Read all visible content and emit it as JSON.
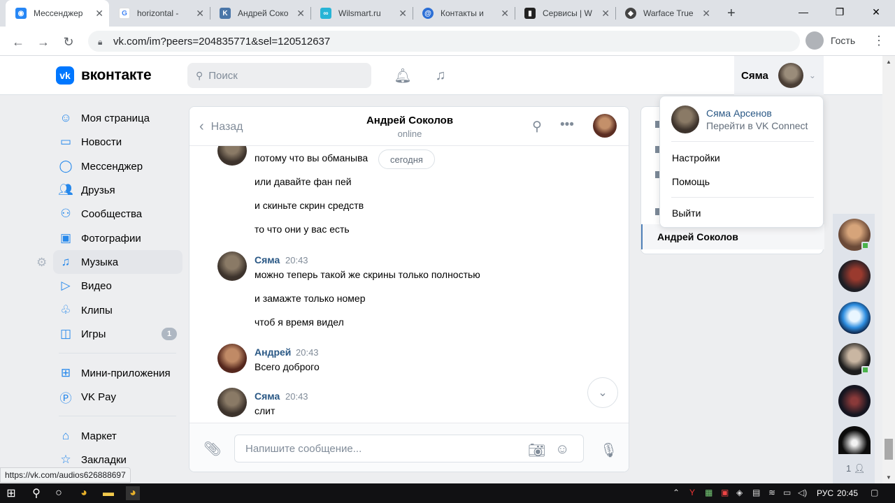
{
  "browser": {
    "tabs": [
      {
        "title": "Мессенджер",
        "fav": "vk-messenger-icon",
        "active": true
      },
      {
        "title": "horizontal - ",
        "fav": "google-icon"
      },
      {
        "title": "Андрей Соко",
        "fav": "vk-icon"
      },
      {
        "title": "Wilsmart.ru",
        "fav": "link-icon"
      },
      {
        "title": "Контакты и",
        "fav": "contacts-icon"
      },
      {
        "title": "Сервисы | W",
        "fav": "services-icon"
      },
      {
        "title": "Warface True",
        "fav": "warface-icon"
      }
    ],
    "url": "vk.com/im?peers=204835771&sel=120512637",
    "guest_label": "Гость",
    "status_url": "https://vk.com/audios626888697"
  },
  "header": {
    "logo_text": "вконтакте",
    "search_placeholder": "Поиск",
    "user_name": "Сяма"
  },
  "sidebar": {
    "items": [
      {
        "label": "Моя страница"
      },
      {
        "label": "Новости"
      },
      {
        "label": "Мессенджер"
      },
      {
        "label": "Друзья"
      },
      {
        "label": "Сообщества"
      },
      {
        "label": "Фотографии"
      },
      {
        "label": "Музыка"
      },
      {
        "label": "Видео"
      },
      {
        "label": "Клипы"
      },
      {
        "label": "Игры",
        "badge": "1"
      },
      {
        "label": "Мини-приложения"
      },
      {
        "label": "VK Pay"
      },
      {
        "label": "Маркет"
      },
      {
        "label": "Закладки"
      }
    ]
  },
  "chat": {
    "back_label": "Назад",
    "peer_name": "Андрей Соколов",
    "peer_status": "online",
    "date_label": "сегодня",
    "input_placeholder": "Напишите сообщение...",
    "messages": [
      {
        "lines": [
          "потому что вы обманыва",
          "или давайте фан пей",
          "и скиньте скрин средств",
          "то что они у вас есть"
        ]
      },
      {
        "author": "Сяма",
        "time": "20:43",
        "lines": [
          "можно теперь такой же скрины только полностью",
          "и замажте только номер",
          "чтоб я время видел"
        ]
      },
      {
        "author": "Андрей",
        "time": "20:43",
        "lines": [
          "Всего доброго"
        ]
      },
      {
        "author": "Сяма",
        "time": "20:43",
        "lines": [
          "слит"
        ]
      }
    ]
  },
  "right_panel": {
    "selected": "Андрей Соколов"
  },
  "dropdown": {
    "name": "Сяма Арсенов",
    "link": "Перейти в VK Connect",
    "settings": "Настройки",
    "help": "Помощь",
    "logout": "Выйти"
  },
  "avatars_column": {
    "count": "1"
  },
  "taskbar": {
    "lang": "РУС",
    "time": "20:45"
  }
}
